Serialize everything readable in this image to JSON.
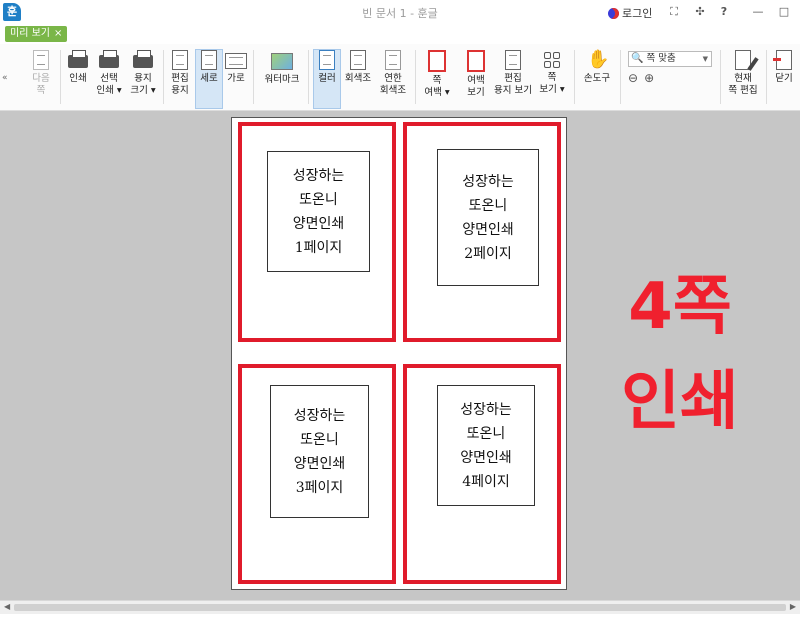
{
  "window": {
    "title": "빈 문서 1 - 훈글",
    "app_icon": "훈",
    "login_label": "로그인",
    "controls": {
      "fullscreen": "⛶",
      "fit": "✣",
      "help": "?",
      "minimize": "—",
      "maximize": "□"
    }
  },
  "tab": {
    "label": "미리 보기",
    "close": "×"
  },
  "ribbon": {
    "collapse": "«",
    "buttons": {
      "next_page": [
        "다음",
        "쪽"
      ],
      "print": [
        "인쇄"
      ],
      "select_print": [
        "선택",
        "인쇄 ▾"
      ],
      "paper_size": [
        "용지",
        "크기 ▾"
      ],
      "edit_paper": [
        "편집",
        "용지"
      ],
      "portrait": [
        "세로"
      ],
      "landscape": [
        "가로"
      ],
      "watermark": [
        "워터마크"
      ],
      "color": [
        "컬러"
      ],
      "grayscale": [
        "회색조"
      ],
      "light_grayscale": [
        "연한",
        "회색조"
      ],
      "page_margin": [
        "쪽",
        "여백 ▾"
      ],
      "margin_view": [
        "여백",
        "보기"
      ],
      "edit_paper_view": [
        "편집",
        "용지 보기"
      ],
      "page_view": [
        "쪽",
        "보기 ▾"
      ],
      "hand_tool": [
        "손도구"
      ],
      "edit_current_page": [
        "현재",
        "쪽 편집"
      ],
      "close": [
        "닫기"
      ]
    },
    "zoom": {
      "value": "쪽 맞춤",
      "zoom_out": "⊖",
      "zoom_in": "⊕"
    }
  },
  "preview": {
    "pages": [
      [
        "성장하는",
        "또온니",
        "양면인쇄",
        "1페이지"
      ],
      [
        "성장하는",
        "또온니",
        "양면인쇄",
        "2페이지"
      ],
      [
        "성장하는",
        "또온니",
        "양면인쇄",
        "3페이지"
      ],
      [
        "성장하는",
        "또온니",
        "양면인쇄",
        "4페이지"
      ]
    ],
    "annotation": [
      "4쪽",
      "인쇄"
    ],
    "annotation_color": "#f0202e",
    "highlight_color": "#e01b2b"
  },
  "scrollbar": {
    "left": "◀",
    "right": "▶"
  }
}
